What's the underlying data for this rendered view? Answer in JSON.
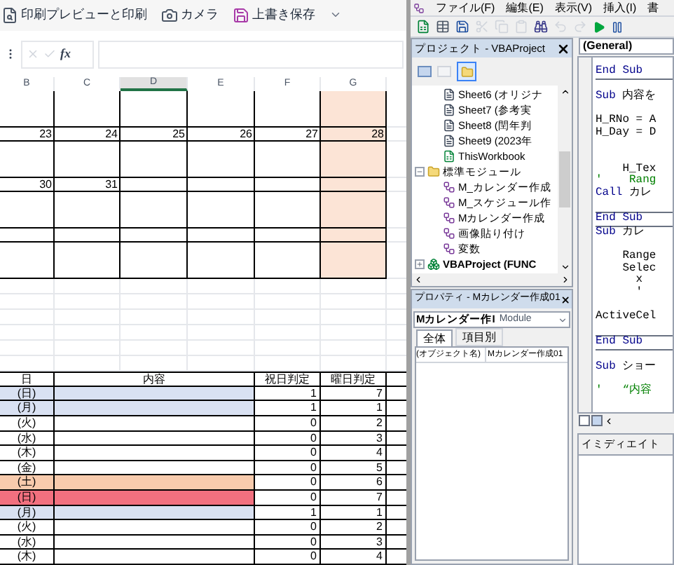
{
  "excel": {
    "toolbar": [
      {
        "kind": "print",
        "label": "印刷プレビューと印刷"
      },
      {
        "kind": "camera",
        "label": "カメラ"
      },
      {
        "kind": "save",
        "label": "上書き保存"
      }
    ],
    "formula_bar": {
      "fx": "fx"
    },
    "columns": [
      {
        "label": "B",
        "selected": false,
        "shaded": false
      },
      {
        "label": "C",
        "selected": false,
        "shaded": false
      },
      {
        "label": "D",
        "selected": true,
        "shaded": false
      },
      {
        "label": "E",
        "selected": false,
        "shaded": false
      },
      {
        "label": "F",
        "selected": false,
        "shaded": false
      },
      {
        "label": "G",
        "selected": false,
        "shaded": true
      }
    ],
    "calendar_rows": [
      {
        "kind": "blank"
      },
      {
        "kind": "dates",
        "cells": [
          "23",
          "24",
          "25",
          "26",
          "27",
          "28"
        ]
      },
      {
        "kind": "blank"
      },
      {
        "kind": "dates",
        "cells": [
          "30",
          "31"
        ]
      },
      {
        "kind": "blank"
      },
      {
        "kind": "thin"
      },
      {
        "kind": "blank"
      }
    ],
    "schedule": {
      "columns": [
        "日",
        "内容",
        "祝日判定",
        "曜日判定"
      ],
      "rows": [
        {
          "day": "(日)",
          "color": "#d9e1f2",
          "holiday": "1",
          "weekday": "7"
        },
        {
          "day": "(月)",
          "color": "#d9e1f2",
          "holiday": "1",
          "weekday": "1"
        },
        {
          "day": "(火)",
          "color": "#ffffff",
          "holiday": "0",
          "weekday": "2"
        },
        {
          "day": "(水)",
          "color": "#ffffff",
          "holiday": "0",
          "weekday": "3"
        },
        {
          "day": "(木)",
          "color": "#ffffff",
          "holiday": "0",
          "weekday": "4"
        },
        {
          "day": "(金)",
          "color": "#ffffff",
          "holiday": "0",
          "weekday": "5"
        },
        {
          "day": "(土)",
          "color": "#f8cbad",
          "holiday": "0",
          "weekday": "6"
        },
        {
          "day": "(日)",
          "color": "#f2707f",
          "holiday": "0",
          "weekday": "7"
        },
        {
          "day": "(月)",
          "color": "#d9e1f2",
          "holiday": "1",
          "weekday": "1"
        },
        {
          "day": "(火)",
          "color": "#ffffff",
          "holiday": "0",
          "weekday": "2"
        },
        {
          "day": "(水)",
          "color": "#ffffff",
          "holiday": "0",
          "weekday": "3"
        },
        {
          "day": "(木)",
          "color": "#ffffff",
          "holiday": "0",
          "weekday": "4"
        }
      ]
    }
  },
  "vbe": {
    "menu": [
      "ファイル(F)",
      "編集(E)",
      "表示(V)",
      "挿入(I)",
      "書"
    ],
    "project": {
      "title": "プロジェクト - VBAProject",
      "tree": [
        {
          "kind": "group",
          "children": [
            {
              "kind": "sheet",
              "label": "Sheet6 (オリジナ"
            },
            {
              "kind": "sheet",
              "label": "Sheet7 (参考実"
            },
            {
              "kind": "sheet",
              "label": "Sheet8 (閏年判"
            },
            {
              "kind": "sheet",
              "label": "Sheet9 (2023年"
            },
            {
              "kind": "workbook",
              "label": "ThisWorkbook"
            }
          ]
        },
        {
          "kind": "folder",
          "label": "標準モジュール",
          "expanded": true,
          "children": [
            {
              "kind": "module",
              "label": "M_カレンダー作成"
            },
            {
              "kind": "module",
              "label": "M_スケジュール作"
            },
            {
              "kind": "module",
              "label": "Mカレンダー作成"
            },
            {
              "kind": "module",
              "label": "画像貼り付け"
            },
            {
              "kind": "module",
              "label": "変数"
            }
          ]
        },
        {
          "kind": "project",
          "label": "VBAProject (FUNC",
          "expanded": false
        }
      ]
    },
    "properties": {
      "title": "プロパティ - Mカレンダー作成01",
      "object_name": "Mカレンダー作I",
      "object_type": "Module",
      "tabs": [
        {
          "label": "全体",
          "selected": true
        },
        {
          "label": "項目別",
          "selected": false
        }
      ],
      "rows": [
        {
          "name": "(オブジェクト名)",
          "value": "Mカレンダー作成01"
        }
      ]
    },
    "code": {
      "procedure": "(General)",
      "lines": [
        {
          "kind": "code",
          "segments": [
            {
              "kind": "keyword",
              "text": "End Sub"
            }
          ]
        },
        {
          "kind": "divider"
        },
        {
          "kind": "blank"
        },
        {
          "kind": "code",
          "segments": [
            {
              "kind": "keyword",
              "text": "Sub"
            },
            {
              "kind": "text",
              "text": " 内容を"
            }
          ]
        },
        {
          "kind": "blank"
        },
        {
          "kind": "code",
          "segments": [
            {
              "kind": "text",
              "text": "H_RNo = A"
            }
          ]
        },
        {
          "kind": "code",
          "segments": [
            {
              "kind": "text",
              "text": "H_Day = D"
            }
          ]
        },
        {
          "kind": "blank"
        },
        {
          "kind": "blank"
        },
        {
          "kind": "code",
          "segments": [
            {
              "kind": "text",
              "text": "    H_Tex"
            }
          ]
        },
        {
          "kind": "code",
          "segments": [
            {
              "kind": "comment",
              "text": "'    Rang"
            }
          ]
        },
        {
          "kind": "code",
          "segments": [
            {
              "kind": "keyword",
              "text": "Call"
            },
            {
              "kind": "text",
              "text": " カレ"
            }
          ]
        },
        {
          "kind": "blank"
        },
        {
          "kind": "divider"
        },
        {
          "kind": "code",
          "segments": [
            {
              "kind": "keyword",
              "text": "End Sub"
            }
          ]
        },
        {
          "kind": "divider"
        },
        {
          "kind": "code",
          "segments": [
            {
              "kind": "keyword",
              "text": "Sub"
            },
            {
              "kind": "text",
              "text": " カレ"
            }
          ]
        },
        {
          "kind": "blank"
        },
        {
          "kind": "code",
          "segments": [
            {
              "kind": "text",
              "text": "    Range"
            }
          ]
        },
        {
          "kind": "code",
          "segments": [
            {
              "kind": "text",
              "text": "    Selec"
            }
          ]
        },
        {
          "kind": "code",
          "segments": [
            {
              "kind": "text",
              "text": "      x"
            }
          ]
        },
        {
          "kind": "code",
          "segments": [
            {
              "kind": "text",
              "text": "      '"
            }
          ]
        },
        {
          "kind": "blank"
        },
        {
          "kind": "code",
          "segments": [
            {
              "kind": "text",
              "text": "ActiveCel"
            }
          ]
        },
        {
          "kind": "blank"
        },
        {
          "kind": "divider"
        },
        {
          "kind": "code",
          "segments": [
            {
              "kind": "keyword",
              "text": "End Sub"
            }
          ]
        },
        {
          "kind": "divider"
        },
        {
          "kind": "blank"
        },
        {
          "kind": "code",
          "segments": [
            {
              "kind": "keyword",
              "text": "Sub"
            },
            {
              "kind": "text",
              "text": " ショー"
            }
          ]
        },
        {
          "kind": "blank"
        },
        {
          "kind": "code",
          "segments": [
            {
              "kind": "comment",
              "text": "'   “内容"
            }
          ]
        }
      ]
    },
    "immediate": {
      "title": "イミディエイト"
    }
  }
}
